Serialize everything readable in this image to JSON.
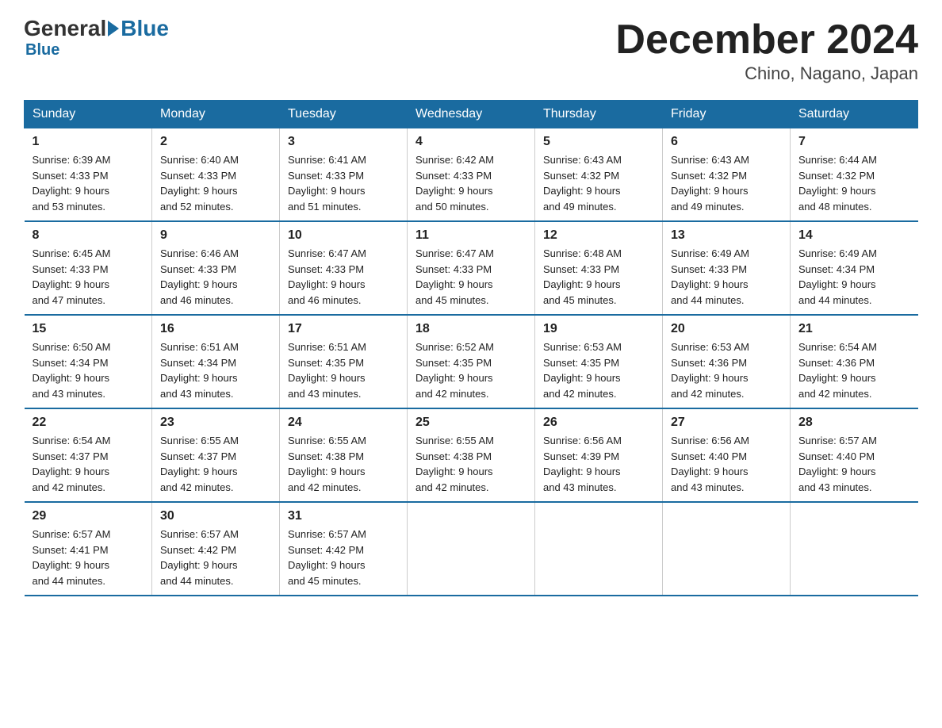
{
  "logo": {
    "general": "General",
    "blue": "Blue"
  },
  "title": "December 2024",
  "subtitle": "Chino, Nagano, Japan",
  "days_of_week": [
    "Sunday",
    "Monday",
    "Tuesday",
    "Wednesday",
    "Thursday",
    "Friday",
    "Saturday"
  ],
  "weeks": [
    [
      {
        "day": "1",
        "sunrise": "6:39 AM",
        "sunset": "4:33 PM",
        "daylight": "9 hours and 53 minutes."
      },
      {
        "day": "2",
        "sunrise": "6:40 AM",
        "sunset": "4:33 PM",
        "daylight": "9 hours and 52 minutes."
      },
      {
        "day": "3",
        "sunrise": "6:41 AM",
        "sunset": "4:33 PM",
        "daylight": "9 hours and 51 minutes."
      },
      {
        "day": "4",
        "sunrise": "6:42 AM",
        "sunset": "4:33 PM",
        "daylight": "9 hours and 50 minutes."
      },
      {
        "day": "5",
        "sunrise": "6:43 AM",
        "sunset": "4:32 PM",
        "daylight": "9 hours and 49 minutes."
      },
      {
        "day": "6",
        "sunrise": "6:43 AM",
        "sunset": "4:32 PM",
        "daylight": "9 hours and 49 minutes."
      },
      {
        "day": "7",
        "sunrise": "6:44 AM",
        "sunset": "4:32 PM",
        "daylight": "9 hours and 48 minutes."
      }
    ],
    [
      {
        "day": "8",
        "sunrise": "6:45 AM",
        "sunset": "4:33 PM",
        "daylight": "9 hours and 47 minutes."
      },
      {
        "day": "9",
        "sunrise": "6:46 AM",
        "sunset": "4:33 PM",
        "daylight": "9 hours and 46 minutes."
      },
      {
        "day": "10",
        "sunrise": "6:47 AM",
        "sunset": "4:33 PM",
        "daylight": "9 hours and 46 minutes."
      },
      {
        "day": "11",
        "sunrise": "6:47 AM",
        "sunset": "4:33 PM",
        "daylight": "9 hours and 45 minutes."
      },
      {
        "day": "12",
        "sunrise": "6:48 AM",
        "sunset": "4:33 PM",
        "daylight": "9 hours and 45 minutes."
      },
      {
        "day": "13",
        "sunrise": "6:49 AM",
        "sunset": "4:33 PM",
        "daylight": "9 hours and 44 minutes."
      },
      {
        "day": "14",
        "sunrise": "6:49 AM",
        "sunset": "4:34 PM",
        "daylight": "9 hours and 44 minutes."
      }
    ],
    [
      {
        "day": "15",
        "sunrise": "6:50 AM",
        "sunset": "4:34 PM",
        "daylight": "9 hours and 43 minutes."
      },
      {
        "day": "16",
        "sunrise": "6:51 AM",
        "sunset": "4:34 PM",
        "daylight": "9 hours and 43 minutes."
      },
      {
        "day": "17",
        "sunrise": "6:51 AM",
        "sunset": "4:35 PM",
        "daylight": "9 hours and 43 minutes."
      },
      {
        "day": "18",
        "sunrise": "6:52 AM",
        "sunset": "4:35 PM",
        "daylight": "9 hours and 42 minutes."
      },
      {
        "day": "19",
        "sunrise": "6:53 AM",
        "sunset": "4:35 PM",
        "daylight": "9 hours and 42 minutes."
      },
      {
        "day": "20",
        "sunrise": "6:53 AM",
        "sunset": "4:36 PM",
        "daylight": "9 hours and 42 minutes."
      },
      {
        "day": "21",
        "sunrise": "6:54 AM",
        "sunset": "4:36 PM",
        "daylight": "9 hours and 42 minutes."
      }
    ],
    [
      {
        "day": "22",
        "sunrise": "6:54 AM",
        "sunset": "4:37 PM",
        "daylight": "9 hours and 42 minutes."
      },
      {
        "day": "23",
        "sunrise": "6:55 AM",
        "sunset": "4:37 PM",
        "daylight": "9 hours and 42 minutes."
      },
      {
        "day": "24",
        "sunrise": "6:55 AM",
        "sunset": "4:38 PM",
        "daylight": "9 hours and 42 minutes."
      },
      {
        "day": "25",
        "sunrise": "6:55 AM",
        "sunset": "4:38 PM",
        "daylight": "9 hours and 42 minutes."
      },
      {
        "day": "26",
        "sunrise": "6:56 AM",
        "sunset": "4:39 PM",
        "daylight": "9 hours and 43 minutes."
      },
      {
        "day": "27",
        "sunrise": "6:56 AM",
        "sunset": "4:40 PM",
        "daylight": "9 hours and 43 minutes."
      },
      {
        "day": "28",
        "sunrise": "6:57 AM",
        "sunset": "4:40 PM",
        "daylight": "9 hours and 43 minutes."
      }
    ],
    [
      {
        "day": "29",
        "sunrise": "6:57 AM",
        "sunset": "4:41 PM",
        "daylight": "9 hours and 44 minutes."
      },
      {
        "day": "30",
        "sunrise": "6:57 AM",
        "sunset": "4:42 PM",
        "daylight": "9 hours and 44 minutes."
      },
      {
        "day": "31",
        "sunrise": "6:57 AM",
        "sunset": "4:42 PM",
        "daylight": "9 hours and 45 minutes."
      },
      null,
      null,
      null,
      null
    ]
  ],
  "labels": {
    "sunrise": "Sunrise:",
    "sunset": "Sunset:",
    "daylight": "Daylight:"
  }
}
